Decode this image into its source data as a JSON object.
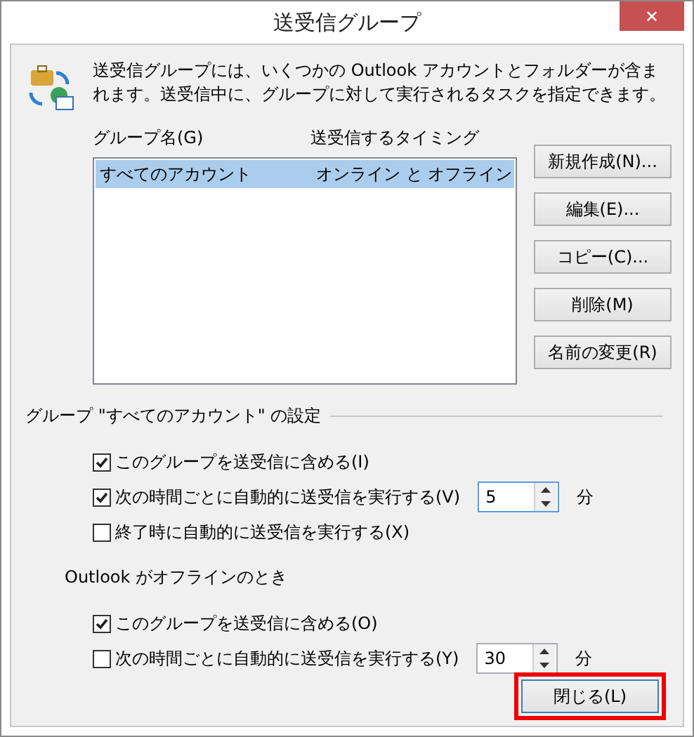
{
  "window": {
    "title": "送受信グループ",
    "close_label": "✕"
  },
  "description": "送受信グループには、いくつかの Outlook アカウントとフォルダーが含まれます。送受信中に、グループに対して実行されるタスクを指定できます。",
  "list": {
    "columns": [
      "グループ名(G)",
      "送受信するタイミング"
    ],
    "rows": [
      {
        "cells": [
          "すべてのアカウント",
          "オンライン と オフライン"
        ],
        "selected": true
      }
    ]
  },
  "side_buttons": [
    "新規作成(N)...",
    "編集(E)...",
    "コピー(C)...",
    "削除(M)",
    "名前の変更(R)"
  ],
  "settings_group": {
    "title": "グループ \"すべてのアカウント\" の設定",
    "online_options": [
      {
        "label": "このグループを送受信に含める(I)",
        "checked": true
      },
      {
        "label": "次の時間ごとに自動的に送受信を実行する(V)",
        "checked": true,
        "spinner": {
          "value": "5",
          "focused": true
        },
        "unit": "分"
      },
      {
        "label": "終了時に自動的に送受信を実行する(X)",
        "checked": false
      }
    ],
    "offline_title": "Outlook がオフラインのとき",
    "offline_options": [
      {
        "label": "このグループを送受信に含める(O)",
        "checked": true
      },
      {
        "label": "次の時間ごとに自動的に送受信を実行する(Y)",
        "checked": false,
        "spinner": {
          "value": "30",
          "focused": false
        },
        "unit": "分"
      }
    ]
  },
  "close_button": {
    "label": "閉じる(L)",
    "highlighted": true
  }
}
